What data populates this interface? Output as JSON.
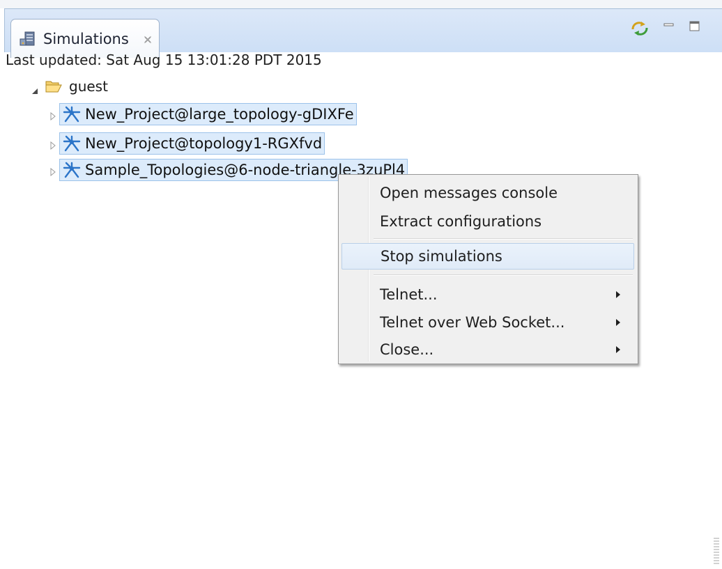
{
  "view": {
    "tab_label": "Simulations",
    "toolbar_icons": [
      "sync-icon",
      "minimize-icon",
      "maximize-icon"
    ]
  },
  "status": {
    "last_updated": "Last updated: Sat Aug 15 13:01:28 PDT 2015"
  },
  "tree": {
    "root": {
      "label": "guest",
      "icon": "folder-open-icon",
      "expanded": true
    },
    "items": [
      {
        "label": "New_Project@large_topology-gDIXFe",
        "icon": "topology-icon",
        "selected": true
      },
      {
        "label": "New_Project@topology1-RGXfvd",
        "icon": "topology-icon",
        "selected": true
      },
      {
        "label": "Sample_Topologies@6-node-triangle-3zuPl4",
        "icon": "topology-icon",
        "selected": true
      }
    ]
  },
  "context_menu": {
    "items": [
      {
        "label": "Open messages console",
        "submenu": false
      },
      {
        "label": "Extract configurations",
        "submenu": false
      },
      {
        "label": "Stop simulations",
        "submenu": false,
        "hovered": true
      },
      {
        "label": "Telnet...",
        "submenu": true
      },
      {
        "label": "Telnet over Web Socket...",
        "submenu": true
      },
      {
        "label": "Close...",
        "submenu": true
      }
    ]
  },
  "colors": {
    "tabbar": "#d5e4f7",
    "selection_fill": "#dcebfb",
    "selection_border": "#9cc2ea",
    "menu_bg": "#f0f0f0",
    "topology_icon": "#2b74c8"
  }
}
